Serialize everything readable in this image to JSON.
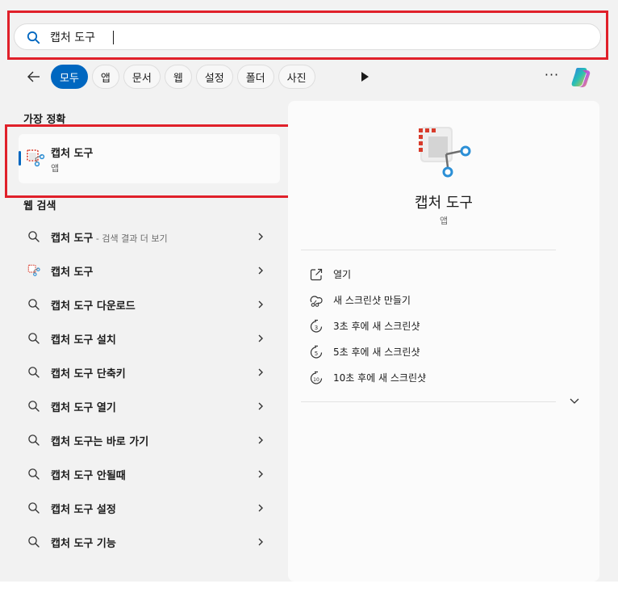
{
  "search": {
    "value": "캡처 도구",
    "placeholder": ""
  },
  "filters": [
    "모두",
    "앱",
    "문서",
    "웹",
    "설정",
    "폴더",
    "사진"
  ],
  "filters_active_index": 0,
  "more_label": "···",
  "best_match": {
    "heading": "가장 정확",
    "title": "캡처 도구",
    "subtitle": "앱"
  },
  "web_search": {
    "heading": "웹 검색",
    "items": [
      {
        "text": "캡처 도구",
        "suffix": " - 검색 결과 더 보기",
        "icon": "search-icon"
      },
      {
        "text": "캡처 도구",
        "suffix": "",
        "icon": "snipping-tool-icon"
      },
      {
        "text": "캡처 도구 다운로드",
        "suffix": "",
        "icon": "search-icon"
      },
      {
        "text": "캡처 도구 설치",
        "suffix": "",
        "icon": "search-icon"
      },
      {
        "text": "캡처 도구 단축키",
        "suffix": "",
        "icon": "search-icon"
      },
      {
        "text": "캡처 도구 열기",
        "suffix": "",
        "icon": "search-icon"
      },
      {
        "text": "캡처 도구는 바로 가기",
        "suffix": "",
        "icon": "search-icon"
      },
      {
        "text": "캡처 도구 안될때",
        "suffix": "",
        "icon": "search-icon"
      },
      {
        "text": "캡처 도구 설정",
        "suffix": "",
        "icon": "search-icon"
      },
      {
        "text": "캡처 도구 기능",
        "suffix": "",
        "icon": "search-icon"
      }
    ]
  },
  "detail": {
    "title": "캡처 도구",
    "subtitle": "앱",
    "actions": [
      {
        "label": "열기",
        "icon": "open-external-icon"
      },
      {
        "label": "새 스크린샷 만들기",
        "icon": "snip-icon"
      },
      {
        "label": "3초 후에 새 스크린샷",
        "icon": "timer-3-icon"
      },
      {
        "label": "5초 후에 새 스크린샷",
        "icon": "timer-5-icon"
      },
      {
        "label": "10초 후에 새 스크린샷",
        "icon": "timer-10-icon"
      }
    ]
  },
  "colors": {
    "accent": "#0067c0",
    "highlight_border": "#e0202a",
    "snip_red": "#d83b2b",
    "snip_blue": "#2b8fd6"
  }
}
